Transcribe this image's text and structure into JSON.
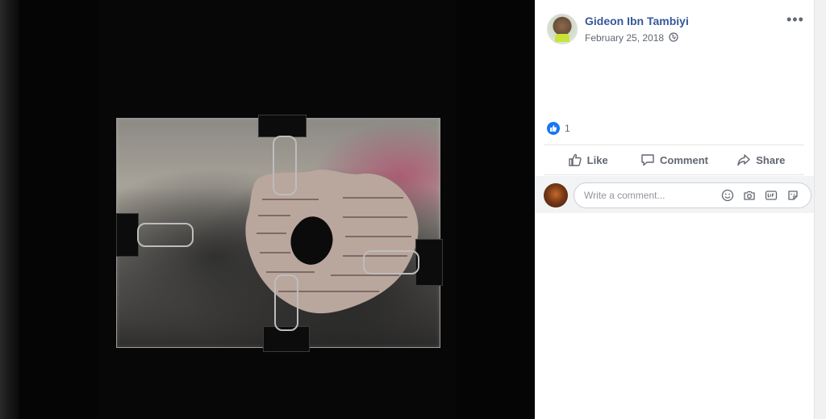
{
  "post": {
    "author": "Gideon Ibn Tambiyi",
    "date": "February 25, 2018",
    "options_label": "•••",
    "reaction_count": "1"
  },
  "actions": {
    "like_label": "Like",
    "comment_label": "Comment",
    "share_label": "Share"
  },
  "comment": {
    "placeholder": "Write a comment..."
  },
  "icons": {
    "globe": "globe-icon",
    "like": "thumbs-up-icon",
    "comment": "speech-bubble-icon",
    "share": "share-arrow-icon",
    "emoji": "smiley-icon",
    "camera": "camera-icon",
    "gif": "gif-icon",
    "sticker": "sticker-icon"
  },
  "colors": {
    "link_blue": "#365899",
    "like_blue": "#1877f2",
    "meta_gray": "#616770"
  }
}
